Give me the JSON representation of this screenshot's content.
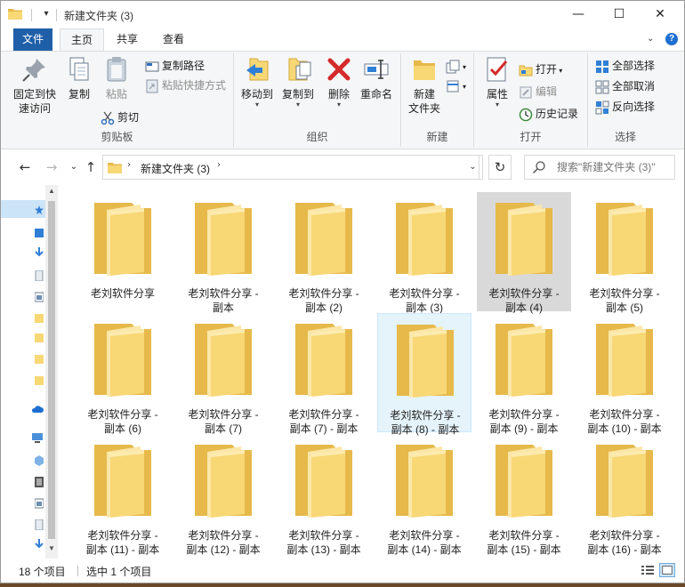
{
  "window": {
    "title": "新建文件夹 (3)"
  },
  "tabs": {
    "file": "文件",
    "home": "主页",
    "share": "共享",
    "view": "查看",
    "help": "?"
  },
  "ribbon": {
    "clipboard": {
      "pin": "固定到快速访问",
      "pin_line1": "固定到快",
      "pin_line2": "速访问",
      "copy": "复制",
      "paste": "粘贴",
      "copy_path": "复制路径",
      "paste_shortcut": "粘贴快捷方式",
      "cut": "剪切",
      "label": "剪贴板"
    },
    "organize": {
      "move_to": "移动到",
      "copy_to": "复制到",
      "delete": "删除",
      "rename": "重命名",
      "label": "组织"
    },
    "new": {
      "new_folder_line1": "新建",
      "new_folder_line2": "文件夹",
      "label": "新建"
    },
    "open": {
      "properties": "属性",
      "open": "打开",
      "edit": "编辑",
      "history": "历史记录",
      "label": "打开"
    },
    "select": {
      "select_all": "全部选择",
      "select_none": "全部取消",
      "invert": "反向选择",
      "label": "选择"
    }
  },
  "address": {
    "path": "新建文件夹 (3)"
  },
  "search": {
    "placeholder": "搜索\"新建文件夹 (3)\""
  },
  "items": [
    {
      "line1": "老刘软件分享",
      "line2": ""
    },
    {
      "line1": "老刘软件分享 -",
      "line2": "副本"
    },
    {
      "line1": "老刘软件分享 -",
      "line2": "副本 (2)"
    },
    {
      "line1": "老刘软件分享 -",
      "line2": "副本 (3)"
    },
    {
      "line1": "老刘软件分享 -",
      "line2": "副本 (4)"
    },
    {
      "line1": "老刘软件分享 -",
      "line2": "副本 (5)"
    },
    {
      "line1": "老刘软件分享 -",
      "line2": "副本 (6)"
    },
    {
      "line1": "老刘软件分享 -",
      "line2": "副本 (7)"
    },
    {
      "line1": "老刘软件分享 -",
      "line2": "副本 (7) - 副本"
    },
    {
      "line1": "老刘软件分享 -",
      "line2": "副本 (8) - 副本"
    },
    {
      "line1": "老刘软件分享 -",
      "line2": "副本 (9) - 副本"
    },
    {
      "line1": "老刘软件分享 -",
      "line2": "副本 (10) - 副本"
    },
    {
      "line1": "老刘软件分享 -",
      "line2": "副本 (11) - 副本"
    },
    {
      "line1": "老刘软件分享 -",
      "line2": "副本 (12) - 副本"
    },
    {
      "line1": "老刘软件分享 -",
      "line2": "副本 (13) - 副本"
    },
    {
      "line1": "老刘软件分享 -",
      "line2": "副本 (14) - 副本"
    },
    {
      "line1": "老刘软件分享 -",
      "line2": "副本 (15) - 副本"
    },
    {
      "line1": "老刘软件分享 -",
      "line2": "副本 (16) - 副本"
    }
  ],
  "status": {
    "count": "18 个项目",
    "selected": "选中 1 个项目"
  },
  "colors": {
    "accent": "#1f5fa8",
    "folder_front": "#f8d775",
    "folder_back": "#e6b94a",
    "selection": "#cce4f7"
  }
}
